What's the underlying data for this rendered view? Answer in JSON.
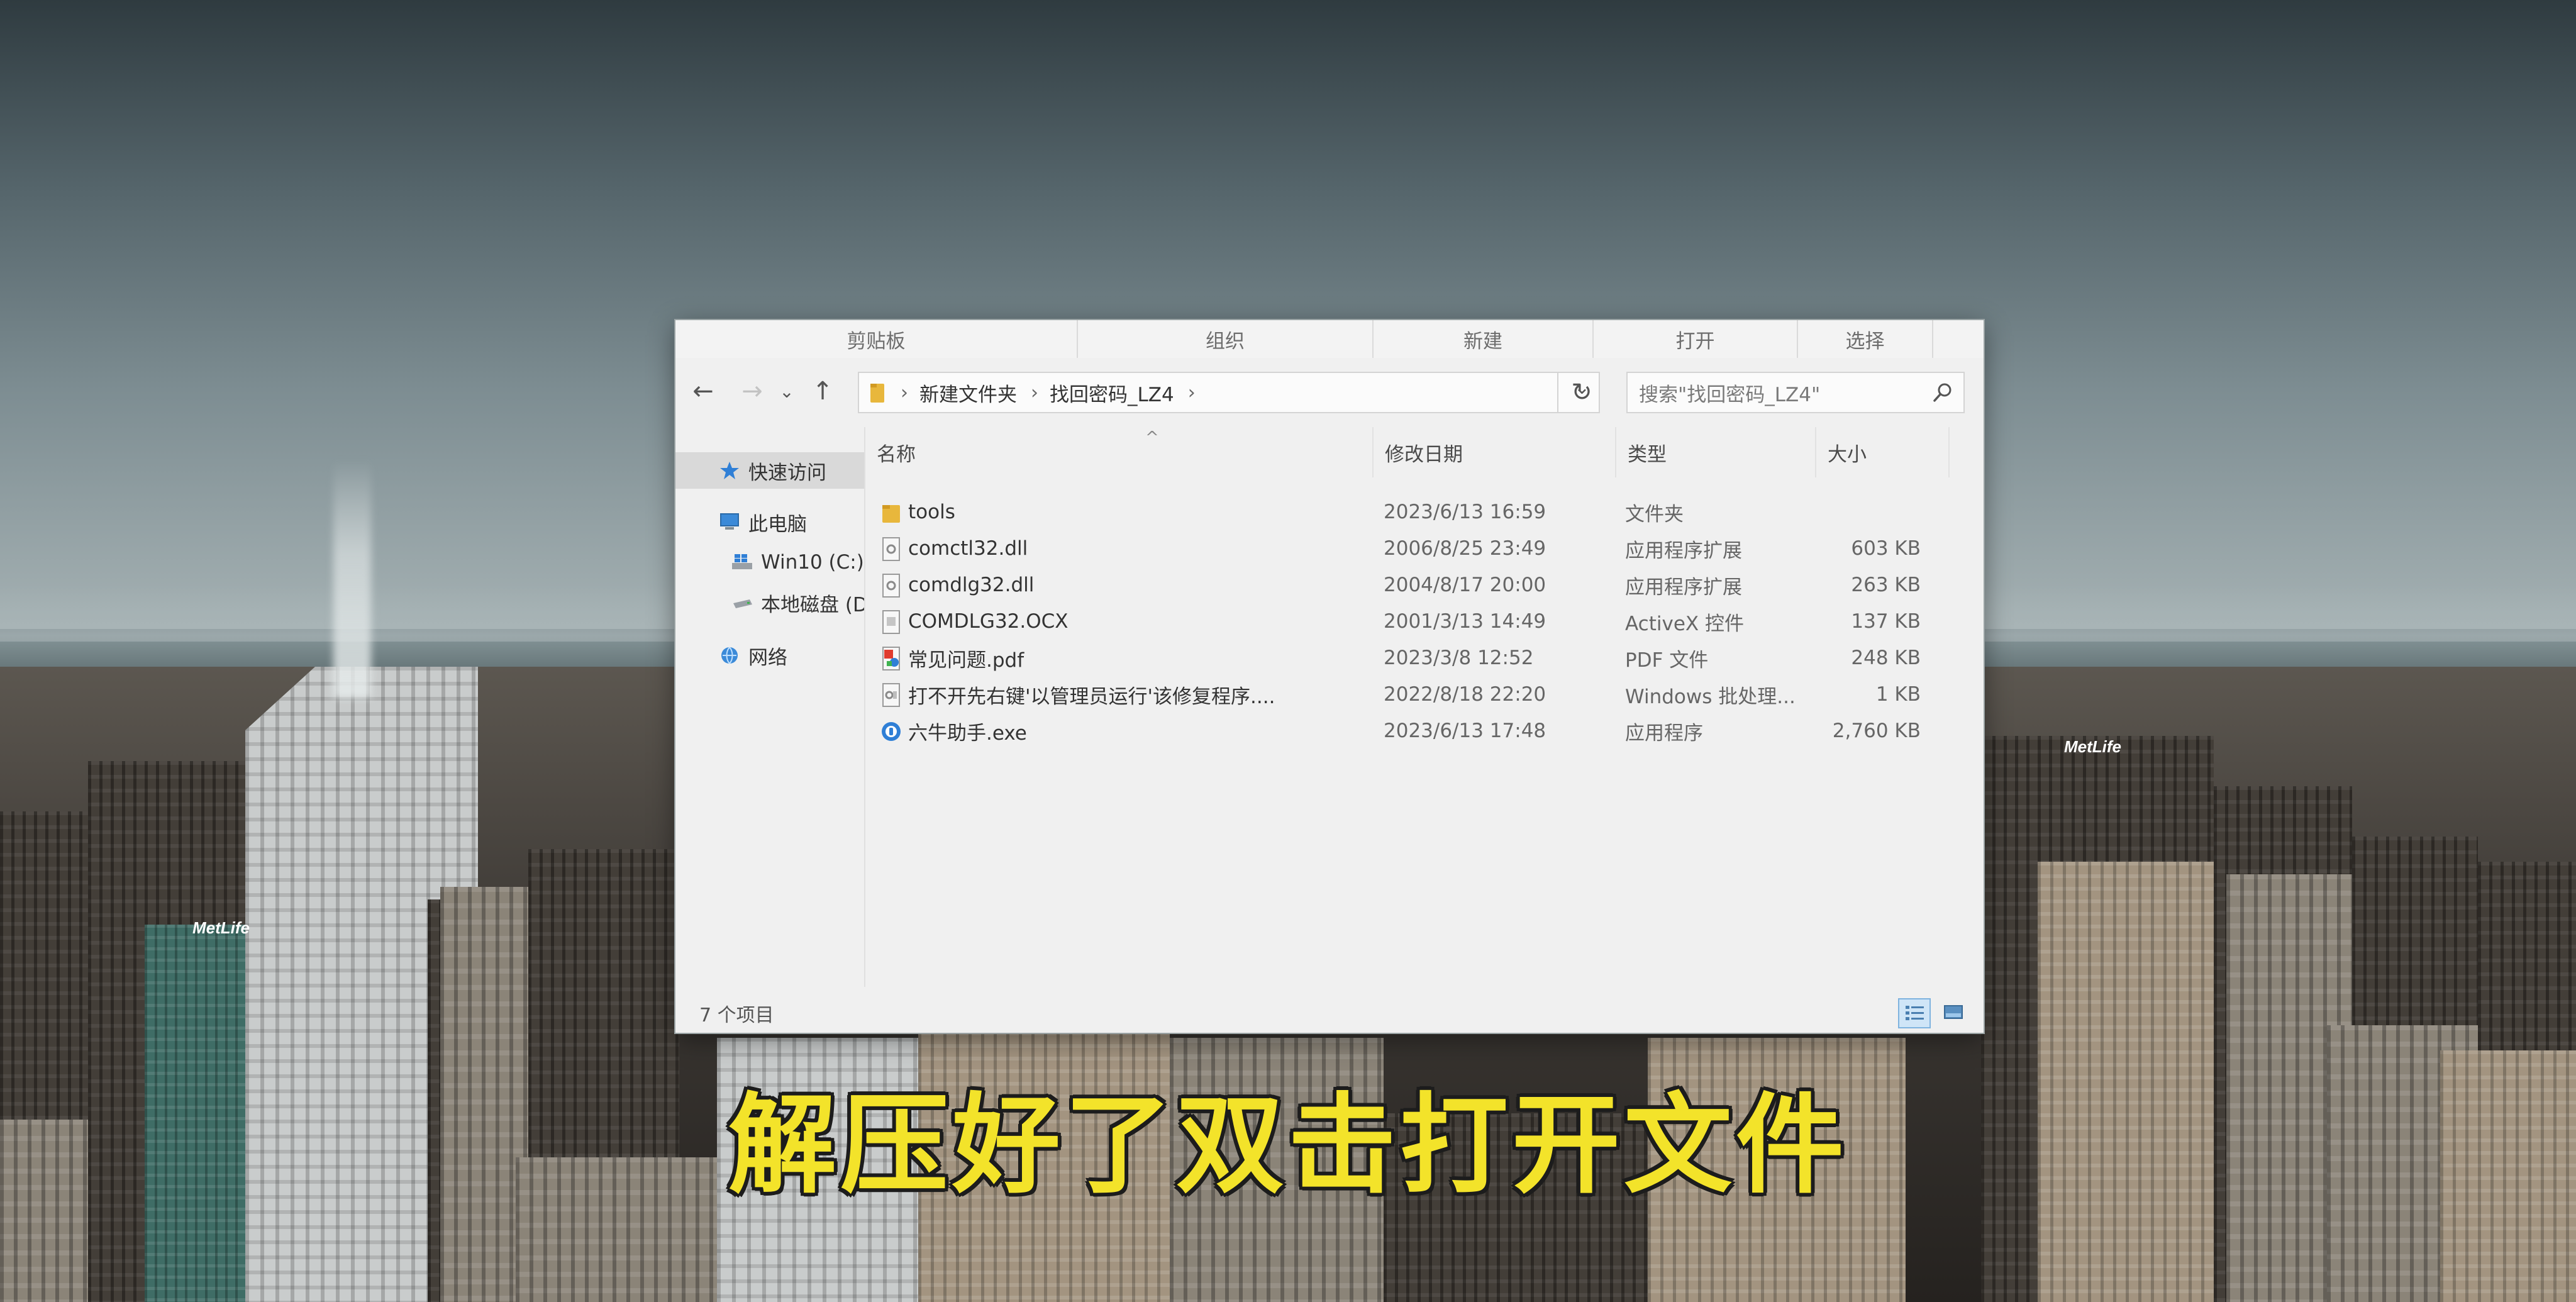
{
  "ribbon": {
    "groups": [
      "剪贴板",
      "组织",
      "新建",
      "打开",
      "选择"
    ]
  },
  "navigation": {
    "back": "←",
    "forward": "→",
    "recent": "⌄",
    "up": "↑"
  },
  "address": {
    "crumbs": [
      "新建文件夹",
      "找回密码_LZ4"
    ],
    "separator": "›",
    "dropdown": "⌄",
    "refresh": "↻"
  },
  "search": {
    "placeholder": "搜索\"找回密码_LZ4\""
  },
  "nav_pane": {
    "items": [
      {
        "label": "快速访问",
        "icon": "star-icon",
        "selected": true
      },
      {
        "label": "此电脑",
        "icon": "computer-icon",
        "selected": false
      },
      {
        "label": "Win10 (C:)",
        "icon": "windows-drive-icon",
        "selected": false
      },
      {
        "label": "本地磁盘 (D",
        "icon": "drive-icon",
        "selected": false
      },
      {
        "label": "网络",
        "icon": "network-icon",
        "selected": false
      }
    ]
  },
  "columns": {
    "name": "名称",
    "date": "修改日期",
    "type": "类型",
    "size": "大小",
    "sort_indicator": "^"
  },
  "files": [
    {
      "name": "tools",
      "date": "2023/6/13 16:59",
      "type": "文件夹",
      "size": "",
      "icon": "folder-icon"
    },
    {
      "name": "comctl32.dll",
      "date": "2006/8/25 23:49",
      "type": "应用程序扩展",
      "size": "603 KB",
      "icon": "dll-file-icon"
    },
    {
      "name": "comdlg32.dll",
      "date": "2004/8/17 20:00",
      "type": "应用程序扩展",
      "size": "263 KB",
      "icon": "dll-file-icon"
    },
    {
      "name": "COMDLG32.OCX",
      "date": "2001/3/13 14:49",
      "type": "ActiveX 控件",
      "size": "137 KB",
      "icon": "ocx-file-icon"
    },
    {
      "name": "常见问题.pdf",
      "date": "2023/3/8 12:52",
      "type": "PDF 文件",
      "size": "248 KB",
      "icon": "pdf-file-icon"
    },
    {
      "name": "打不开先右键'以管理员运行'该修复程序....",
      "date": "2022/8/18 22:20",
      "type": "Windows 批处理...",
      "size": "1 KB",
      "icon": "batch-file-icon"
    },
    {
      "name": "六牛助手.exe",
      "date": "2023/6/13 17:48",
      "type": "应用程序",
      "size": "2,760 KB",
      "icon": "exe-app-icon"
    }
  ],
  "status": {
    "item_count": "7 个项目"
  },
  "caption": {
    "text": "解压好了双击打开文件"
  },
  "background": {
    "signs": [
      "MetLife",
      "MetLife"
    ]
  },
  "colors": {
    "caption_fill": "#f3e32a",
    "caption_outline": "#1c1c1c",
    "selection": "#cfe5f7",
    "folder": "#e8b73c"
  }
}
